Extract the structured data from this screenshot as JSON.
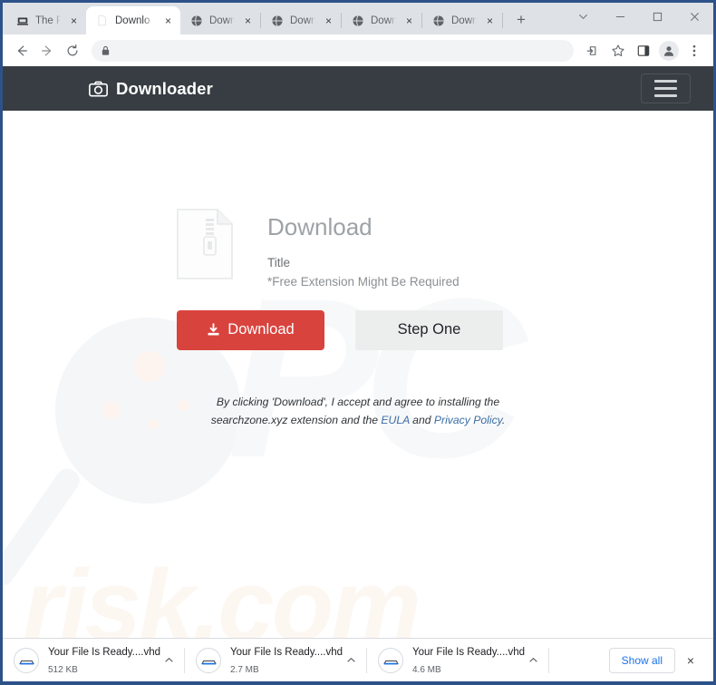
{
  "browser": {
    "tabs": [
      {
        "title": "The Pira",
        "favicon": "pirate-bay-icon",
        "active": false
      },
      {
        "title": "Downlo",
        "favicon": "page-icon",
        "active": true
      },
      {
        "title": "Downlo",
        "favicon": "globe-icon",
        "active": false
      },
      {
        "title": "Downlo",
        "favicon": "globe-icon",
        "active": false
      },
      {
        "title": "Downlo",
        "favicon": "globe-icon",
        "active": false
      },
      {
        "title": "Downlo",
        "favicon": "globe-icon",
        "active": false
      }
    ],
    "new_tab_label": "+",
    "tab_close_label": "×",
    "window_controls": {
      "tab_search": "tab-search-icon",
      "minimize": "minimize-icon",
      "maximize": "maximize-icon",
      "close": "close-icon"
    },
    "toolbar": {
      "back": "back-arrow-icon",
      "forward": "forward-arrow-icon",
      "reload": "reload-icon",
      "lock": "lock-icon",
      "url_value": "",
      "url_placeholder": "",
      "share": "share-icon",
      "bookmark": "star-icon",
      "side_panel": "side-panel-icon",
      "profile": "profile-avatar-icon",
      "menu": "three-dot-menu-icon"
    }
  },
  "site": {
    "brand": "Downloader",
    "brand_icon": "camera-icon",
    "menu_toggle": "hamburger-menu-icon",
    "header_bg": "#373d42"
  },
  "card": {
    "file_icon": "zip-file-icon",
    "heading": "Download",
    "subtitle": "Title",
    "note": "*Free Extension Might Be Required",
    "download_button": "Download",
    "download_button_icon": "download-arrow-icon",
    "download_button_color": "#d9433e",
    "step_button": "Step One"
  },
  "disclaimer": {
    "part1": "By clicking 'Download', I accept and agree to installing the searchzone.xyz extension and the ",
    "link1": "EULA",
    "part2": " and ",
    "link2": "Privacy Policy",
    "part3": ".",
    "link_color": "#3a6ea5"
  },
  "watermarks": {
    "pc": "PC",
    "risk": "risk.com"
  },
  "downloads": {
    "items": [
      {
        "name": "Your File Is Ready....vhd",
        "size": "512 KB",
        "icon": "disk-drive-icon",
        "caret": "chevron-up-icon"
      },
      {
        "name": "Your File Is Ready....vhd",
        "size": "2.7 MB",
        "icon": "disk-drive-icon",
        "caret": "chevron-up-icon"
      },
      {
        "name": "Your File Is Ready....vhd",
        "size": "4.6 MB",
        "icon": "disk-drive-icon",
        "caret": "chevron-up-icon"
      }
    ],
    "show_all": "Show all",
    "close": "×"
  }
}
